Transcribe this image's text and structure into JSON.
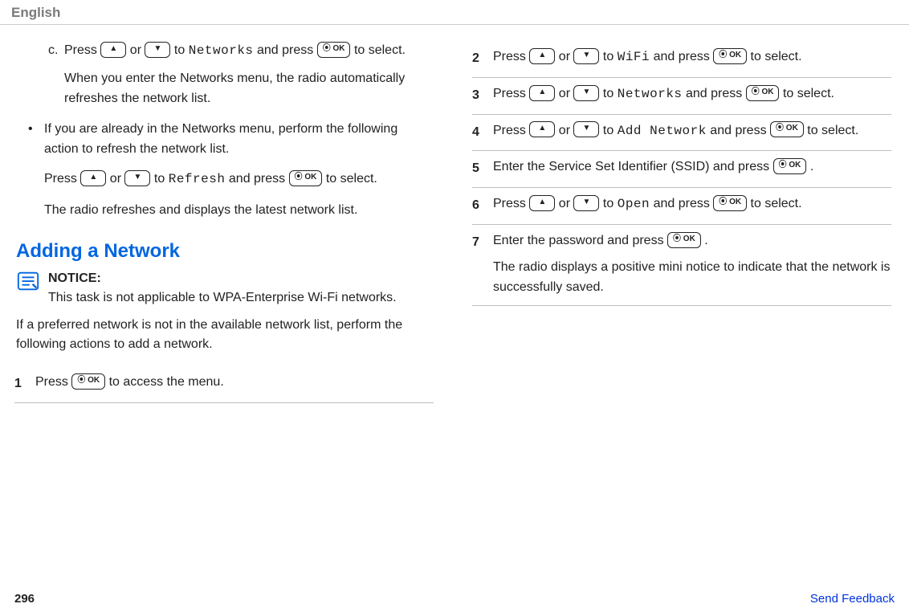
{
  "header": {
    "lang": "English"
  },
  "left": {
    "c": {
      "label": "c.",
      "line1a": "Press ",
      "line1b": " or ",
      "line1c": " to ",
      "networks": "Networks",
      "line1d": " and press ",
      "line2a": " to select.",
      "desc": "When you enter the Networks menu, the radio automatically refreshes the network list."
    },
    "bullet": {
      "mark": "•",
      "text": "If you are already in the Networks menu, perform the following action to refresh the network list."
    },
    "refresh": {
      "a": "Press ",
      "b": " or ",
      "c": " to ",
      "word": "Refresh",
      "d": " and press ",
      "e": " to select."
    },
    "result": "The radio refreshes and displays the latest network list.",
    "section": "Adding a Network",
    "notice": {
      "heading": "NOTICE:",
      "body": "This task is not applicable to WPA-Enterprise Wi-Fi networks."
    },
    "intro": "If a preferred network is not in the available network list, perform the following actions to add a network.",
    "step1": {
      "num": "1",
      "a": "Press ",
      "b": " to access the menu."
    }
  },
  "right": {
    "step2": {
      "num": "2",
      "a": "Press ",
      "b": " or ",
      "c": " to ",
      "word": "WiFi",
      "d": " and press ",
      "e": " to select."
    },
    "step3": {
      "num": "3",
      "a": "Press ",
      "b": " or ",
      "c": " to ",
      "word": "Networks",
      "d": " and press ",
      "e": " to select."
    },
    "step4": {
      "num": "4",
      "a": "Press ",
      "b": " or ",
      "c": " to ",
      "word": "Add Network",
      "d": " and press ",
      "e": " to select."
    },
    "step5": {
      "num": "5",
      "a": "Enter the Service Set Identifier (SSID) and press ",
      "b": " ."
    },
    "step6": {
      "num": "6",
      "a": "Press ",
      "b": " or ",
      "c": " to ",
      "word": "Open",
      "d": " and press ",
      "e": " to select."
    },
    "step7": {
      "num": "7",
      "a": "Enter the password and press ",
      "b": " .",
      "result": "The radio displays a positive mini notice to indicate that the network is successfully saved."
    }
  },
  "keys": {
    "up": "▲",
    "down": "▼",
    "ok": "⦿ OK"
  },
  "footer": {
    "page": "296",
    "feedback": "Send Feedback"
  }
}
